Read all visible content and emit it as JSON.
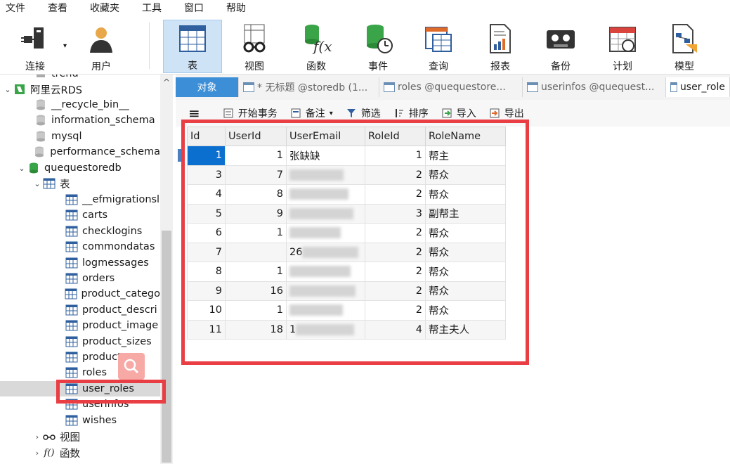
{
  "menubar": [
    "文件",
    "查看",
    "收藏夹",
    "工具",
    "窗口",
    "帮助"
  ],
  "toolbar": [
    {
      "label": "连接",
      "icon": "plug-icon"
    },
    {
      "label": "用户",
      "icon": "user-icon"
    },
    {
      "label": "表",
      "icon": "table-icon",
      "active": true
    },
    {
      "label": "视图",
      "icon": "view-glasses-icon"
    },
    {
      "label": "函数",
      "icon": "function-icon"
    },
    {
      "label": "事件",
      "icon": "event-clock-icon"
    },
    {
      "label": "查询",
      "icon": "query-icon"
    },
    {
      "label": "报表",
      "icon": "report-icon"
    },
    {
      "label": "备份",
      "icon": "backup-tape-icon"
    },
    {
      "label": "计划",
      "icon": "calendar-icon"
    },
    {
      "label": "模型",
      "icon": "model-icon"
    }
  ],
  "sidebar": {
    "top_partial": "trend",
    "connection": "阿里云RDS",
    "databases": [
      "__recycle_bin__",
      "information_schema",
      "mysql",
      "performance_schema",
      "quequestoredb"
    ],
    "tables_group": "表",
    "tables": [
      "__efmigrationsl",
      "carts",
      "checklogins",
      "commondatas",
      "logmessages",
      "orders",
      "product_catego",
      "product_descri",
      "product_image",
      "product_sizes",
      "products",
      "roles",
      "user_roles",
      "userinfos",
      "wishes"
    ],
    "views_group": "视图",
    "functions_group": "函数",
    "selected": "user_roles"
  },
  "tabs": {
    "objects": "对象",
    "items": [
      "* 无标题 @storedb (1...",
      "roles @quequestore...",
      "userinfos @quequest...",
      "user_role"
    ]
  },
  "objtoolbar": {
    "begin_tx": "开始事务",
    "note": "备注",
    "filter": "筛选",
    "sort": "排序",
    "import": "导入",
    "export": "导出"
  },
  "grid": {
    "columns": [
      "Id",
      "UserId",
      "UserEmail",
      "RoleId",
      "RoleName"
    ],
    "rows": [
      {
        "id": "1",
        "userid": "1",
        "email": "张缺缺",
        "roleid": "1",
        "rolename": "帮主"
      },
      {
        "id": "3",
        "userid": "7",
        "email": "",
        "roleid": "2",
        "rolename": "帮众"
      },
      {
        "id": "4",
        "userid": "8",
        "email": "",
        "roleid": "2",
        "rolename": "帮众"
      },
      {
        "id": "5",
        "userid": "9",
        "email": "",
        "roleid": "3",
        "rolename": "副帮主"
      },
      {
        "id": "6",
        "userid": "1",
        "email": "",
        "roleid": "2",
        "rolename": "帮众"
      },
      {
        "id": "7",
        "userid": "",
        "email": "26",
        "roleid": "2",
        "rolename": "帮众"
      },
      {
        "id": "8",
        "userid": "1",
        "email": "",
        "roleid": "2",
        "rolename": "帮众"
      },
      {
        "id": "9",
        "userid": "16",
        "email": "",
        "roleid": "2",
        "rolename": "帮众"
      },
      {
        "id": "10",
        "userid": "1",
        "email": "",
        "roleid": "2",
        "rolename": "帮众"
      },
      {
        "id": "11",
        "userid": "18",
        "email": "1",
        "roleid": "4",
        "rolename": "帮主夫人"
      }
    ]
  },
  "colors": {
    "accent": "#3c8fd6",
    "selected_cell": "#0b6fd0",
    "annotation_red": "#ea3e45"
  }
}
